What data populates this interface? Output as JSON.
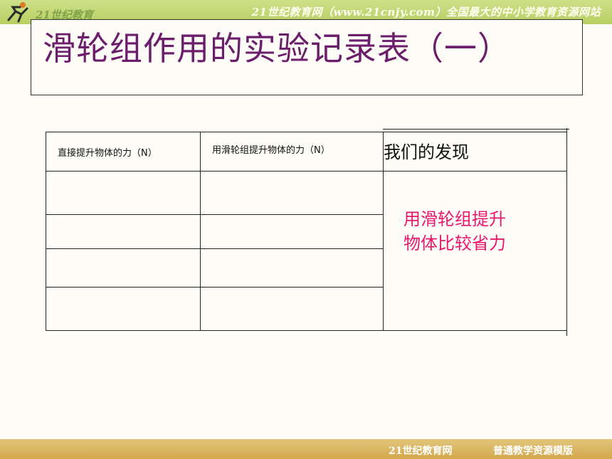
{
  "header": {
    "logo_text": "21世纪教育",
    "banner": "21世纪教育网（www.21cnjy.com）全国最大的中小学教育资源网站"
  },
  "slide": {
    "title": "滑轮组作用的实验记录表（一）"
  },
  "table": {
    "headers": [
      "直接提升物体的力（N）",
      "用滑轮组提升物体的力（N）",
      "我们的发现"
    ],
    "finding_line1": "用滑轮组提升",
    "finding_line2": "物体比较省力"
  },
  "footer": {
    "left": "21世纪教育网",
    "right": "普通教学资源模版"
  },
  "colors": {
    "title": "#6c1d6c",
    "finding": "#e8186e",
    "top_band": "#b7cf62",
    "bottom_band": "#d4a84d"
  }
}
